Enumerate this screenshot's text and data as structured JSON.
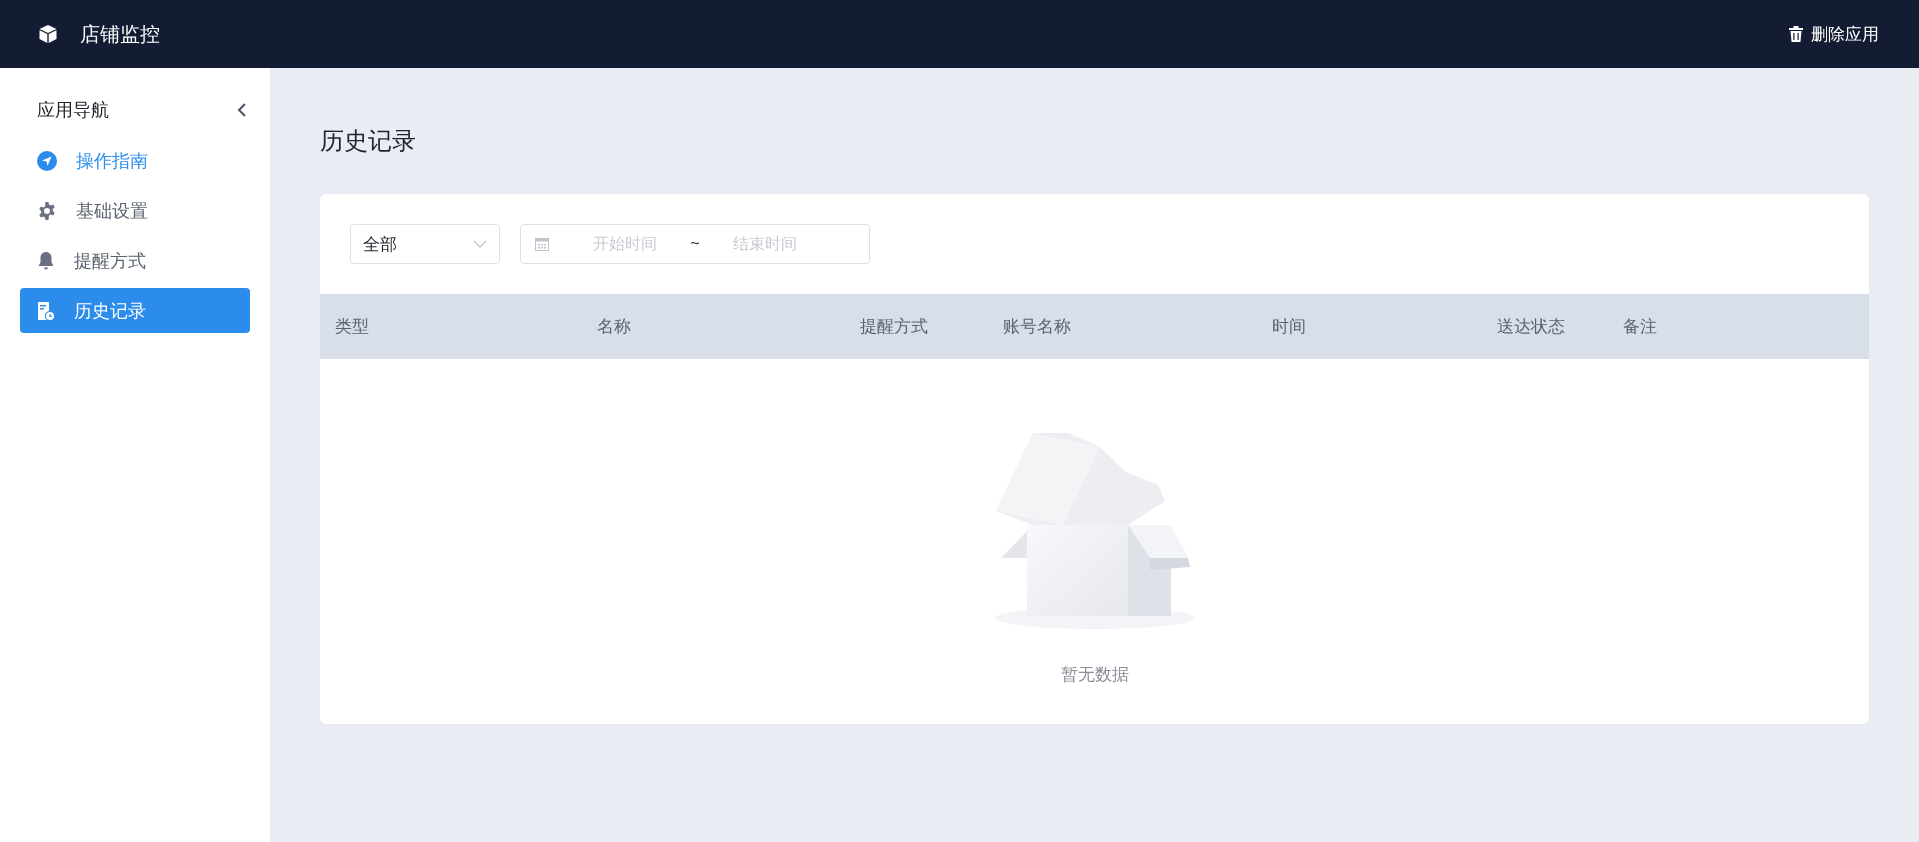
{
  "header": {
    "title": "店铺监控",
    "action": "删除应用"
  },
  "sidebar": {
    "title": "应用导航",
    "items": [
      {
        "kind": "guide",
        "label": "操作指南",
        "selected": false,
        "highlighted": true
      },
      {
        "kind": "settings",
        "label": "基础设置",
        "selected": false,
        "highlighted": false
      },
      {
        "kind": "bell",
        "label": "提醒方式",
        "selected": false,
        "highlighted": false
      },
      {
        "kind": "history",
        "label": "历史记录",
        "selected": true,
        "highlighted": false
      }
    ]
  },
  "page": {
    "title": "历史记录"
  },
  "filters": {
    "type_select": {
      "value": "全部"
    },
    "date_range": {
      "start_placeholder": "开始时间",
      "separator": "~",
      "end_placeholder": "结束时间"
    }
  },
  "table": {
    "columns": [
      "类型",
      "名称",
      "提醒方式",
      "账号名称",
      "时间",
      "送达状态",
      "备注"
    ],
    "empty_text": "暂无数据"
  }
}
